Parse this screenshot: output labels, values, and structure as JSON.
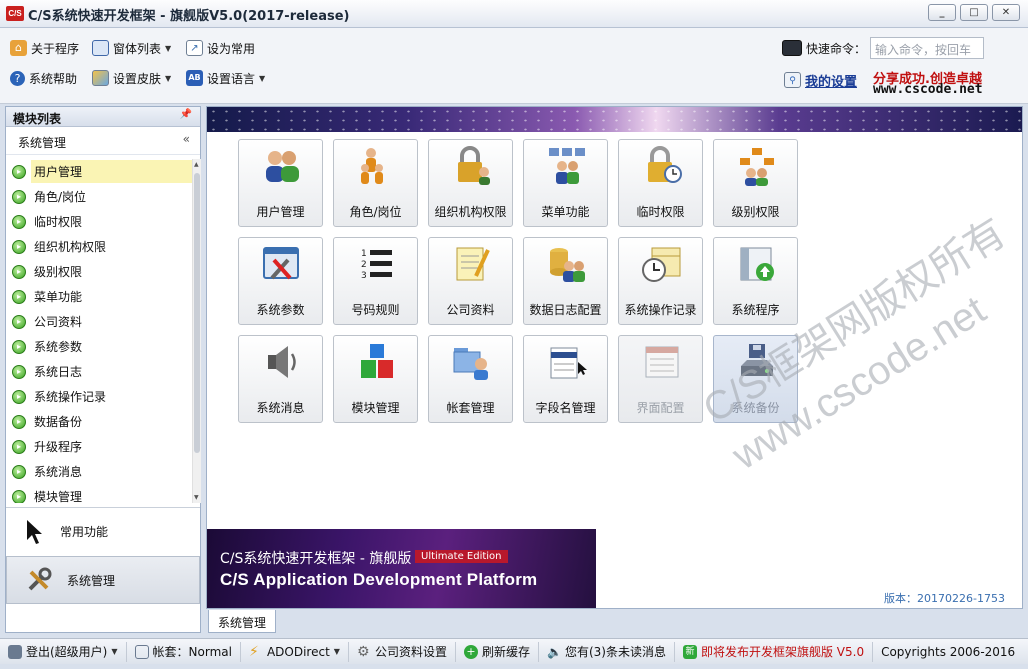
{
  "window": {
    "logo_text": "C/S",
    "title": "C/S系统快速开发框架 - 旗舰版V5.0(2017-release)",
    "min": "_",
    "max": "□",
    "close": "✕"
  },
  "toolbar": {
    "about": "关于程序",
    "window_list": "窗体列表",
    "set_common": "设为常用",
    "help": "系统帮助",
    "skin": "设置皮肤",
    "language": "设置语言",
    "quick_command_label": "快速命令：",
    "quick_command_placeholder": "输入命令，按回车",
    "my_settings": "我的设置",
    "brand_slogan": "分享成功.创造卓越",
    "brand_site": "www.cscode.net"
  },
  "sidebar": {
    "header": "模块列表",
    "group": "系统管理",
    "items": [
      {
        "label": "用户管理",
        "selected": true
      },
      {
        "label": "角色/岗位"
      },
      {
        "label": "临时权限"
      },
      {
        "label": "组织机构权限"
      },
      {
        "label": "级别权限"
      },
      {
        "label": "菜单功能"
      },
      {
        "label": "公司资料"
      },
      {
        "label": "系统参数"
      },
      {
        "label": "系统日志"
      },
      {
        "label": "系统操作记录"
      },
      {
        "label": "数据备份"
      },
      {
        "label": "升级程序"
      },
      {
        "label": "系统消息"
      },
      {
        "label": "模块管理"
      }
    ],
    "nav_common": "常用功能",
    "nav_mgmt": "系统管理"
  },
  "tiles": [
    {
      "label": "用户管理",
      "icon": "users-icon"
    },
    {
      "label": "角色/岗位",
      "icon": "role-icon"
    },
    {
      "label": "组织机构权限",
      "icon": "org-lock-icon"
    },
    {
      "label": "菜单功能",
      "icon": "menu-users-icon"
    },
    {
      "label": "临时权限",
      "icon": "lock-clock-icon"
    },
    {
      "label": "级别权限",
      "icon": "level-icon"
    },
    {
      "label": "系统参数",
      "icon": "tools-icon"
    },
    {
      "label": "号码规则",
      "icon": "numbered-list-icon"
    },
    {
      "label": "公司资料",
      "icon": "notepad-icon"
    },
    {
      "label": "数据日志配置",
      "icon": "database-users-icon"
    },
    {
      "label": "系统操作记录",
      "icon": "calendar-clock-icon"
    },
    {
      "label": "系统程序",
      "icon": "upgrade-icon"
    },
    {
      "label": "系统消息",
      "icon": "speaker-icon"
    },
    {
      "label": "模块管理",
      "icon": "blocks-icon"
    },
    {
      "label": "帐套管理",
      "icon": "folder-user-icon"
    },
    {
      "label": "字段名管理",
      "icon": "fields-icon"
    },
    {
      "label": "界面配置",
      "icon": "window-icon",
      "disabled": true
    },
    {
      "label": "系统备份",
      "icon": "backup-drive-icon",
      "active": true
    }
  ],
  "banner": {
    "cn_title": "C/S系统快速开发框架 - 旗舰版",
    "edition": "Ultimate Edition",
    "en_title": "C/S Application Development Platform"
  },
  "version": "版本：20170226-1753",
  "watermark": {
    "line1": "C/S框架网版权所有",
    "line2": "www.cscode.net"
  },
  "tab": "系统管理",
  "status": {
    "login": "登出(超级用户)",
    "account": "帐套：Normal",
    "ado": "ADODirect",
    "company": "公司资料设置",
    "refresh": "刷新缓存",
    "messages": "您有(3)条未读消息",
    "release": "即将发布开发框架旗舰版 V5.0",
    "copyright": "Copyrights 2006-2016"
  },
  "colors": {
    "brand_red": "#c01010",
    "link_blue": "#1a3c96",
    "selected_bg": "#faf4b4"
  }
}
